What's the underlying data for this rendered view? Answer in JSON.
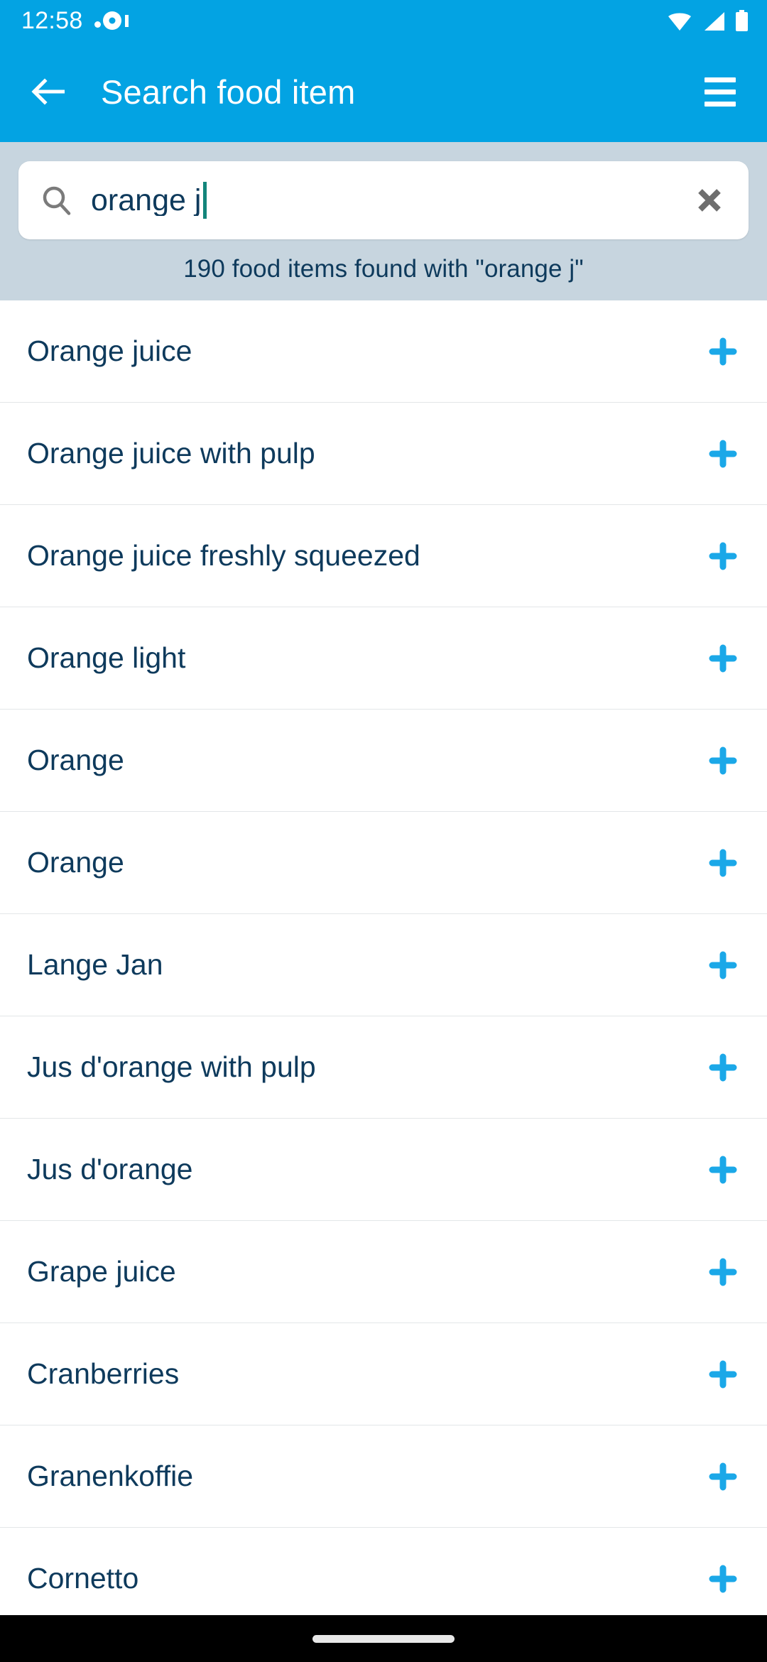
{
  "status_bar": {
    "time": "12:58",
    "notification_icon": "record-dot-icon",
    "wifi_icon": "wifi-icon",
    "signal_icon": "cellular-signal-icon",
    "battery_icon": "battery-full-icon"
  },
  "app_bar": {
    "back_icon": "arrow-left-icon",
    "title": "Search food item",
    "menu_icon": "hamburger-menu-icon"
  },
  "search": {
    "search_icon": "search-icon",
    "value": "orange j",
    "placeholder": "Search food item",
    "clear_icon": "close-x-icon",
    "result_count_text": "190 food items found with \"orange j\""
  },
  "results": {
    "add_icon": "plus-icon",
    "items": [
      {
        "label": "Orange juice"
      },
      {
        "label": "Orange juice with pulp"
      },
      {
        "label": "Orange juice freshly squeezed"
      },
      {
        "label": "Orange light"
      },
      {
        "label": "Orange"
      },
      {
        "label": "Orange"
      },
      {
        "label": "Lange Jan"
      },
      {
        "label": "Jus d'orange with pulp"
      },
      {
        "label": "Jus d'orange"
      },
      {
        "label": "Grape juice"
      },
      {
        "label": "Cranberries"
      },
      {
        "label": "Granenkoffie"
      },
      {
        "label": "Cornetto"
      }
    ]
  },
  "nav_bar": {
    "home_indicator": "home-indicator"
  },
  "colors": {
    "brand_blue": "#03a3e3",
    "accent_cyan": "#1ba8e8",
    "search_panel_bg": "#c7d5df",
    "text_navy": "#0e3a5c",
    "caret_teal": "#13857b",
    "divider": "#e3e6e8",
    "nav_black": "#000000"
  }
}
